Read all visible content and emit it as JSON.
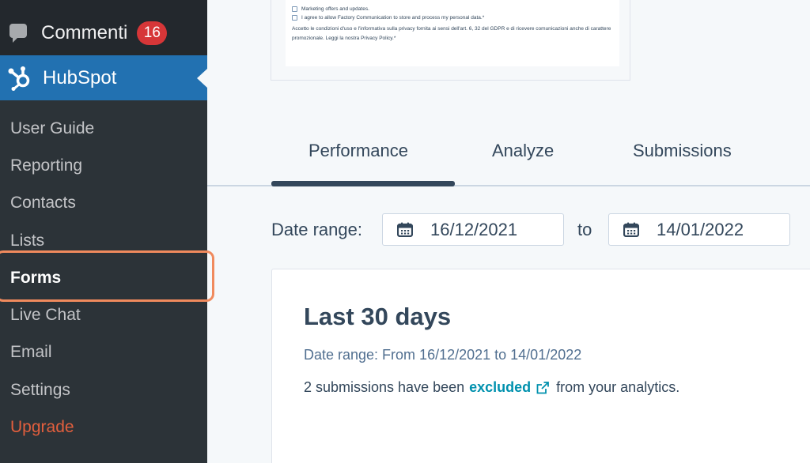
{
  "sidebar": {
    "comments_label": "Commenti",
    "comments_count": "16",
    "hubspot_label": "HubSpot",
    "items": [
      {
        "label": "User Guide"
      },
      {
        "label": "Reporting"
      },
      {
        "label": "Contacts"
      },
      {
        "label": "Lists"
      },
      {
        "label": "Forms"
      },
      {
        "label": "Live Chat"
      },
      {
        "label": "Email"
      },
      {
        "label": "Settings"
      },
      {
        "label": "Upgrade"
      }
    ],
    "current_item": "Forms"
  },
  "form_preview": {
    "line1": "Marketing offers and updates.",
    "line2": "I agree to allow Factory Communication to store and process my personal data.*",
    "privacy_text": "Accetto le condizioni d'uso e l'informativa sulla privacy fornita ai sensi dell'art. 6, 32 del GDPR e di ricevere comunicazioni anche di carattere promozionale. Leggi la nostra Privacy Policy.*"
  },
  "tabs": [
    {
      "label": "Performance",
      "active": true
    },
    {
      "label": "Analyze",
      "active": false
    },
    {
      "label": "Submissions",
      "active": false
    }
  ],
  "date_range": {
    "label": "Date range:",
    "start": "16/12/2021",
    "to_label": "to",
    "end": "14/01/2022"
  },
  "summary": {
    "title": "Last 30 days",
    "range_text": "Date range: From 16/12/2021 to 14/01/2022",
    "note_before": "2 submissions have been",
    "note_link": "excluded",
    "note_after": "from your analytics."
  },
  "icons": {
    "comments": "comment-bubble-icon",
    "hubspot": "hubspot-sprocket-icon",
    "calendar": "calendar-icon",
    "external": "external-link-icon"
  },
  "colors": {
    "sidebar_bg": "#2c3338",
    "active_blue": "#2271b1",
    "badge_red": "#d63638",
    "upgrade_orange": "#e35f3d",
    "highlight_orange": "#f08a5d",
    "text_dark": "#33475b",
    "link_teal": "#0091ae"
  }
}
